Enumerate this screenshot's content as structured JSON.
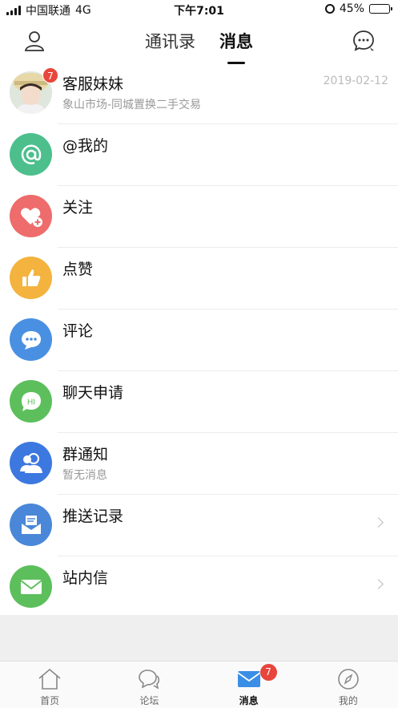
{
  "status_bar": {
    "carrier": "中国联通",
    "network": "4G",
    "time": "下午7:01",
    "battery": "45%",
    "battery_level": 0.45
  },
  "header": {
    "tabs": [
      {
        "label": "通讯录",
        "active": false
      },
      {
        "label": "消息",
        "active": true
      }
    ],
    "profile_icon": "person-icon",
    "chat_icon": "chat-bubble-icon"
  },
  "messages": [
    {
      "title": "客服妹妹",
      "subtitle": "象山市场-同城置换二手交易",
      "date": "2019-02-12",
      "badge": "7",
      "icon": "customer-service-avatar"
    },
    {
      "title": "@我的",
      "subtitle": "",
      "icon": "at-icon",
      "color": "#4cbf8c"
    },
    {
      "title": "关注",
      "subtitle": "",
      "icon": "heart-plus-icon",
      "color": "#ee6c6c"
    },
    {
      "title": "点赞",
      "subtitle": "",
      "icon": "thumbs-up-icon",
      "color": "#f3b33e"
    },
    {
      "title": "评论",
      "subtitle": "",
      "icon": "comment-icon",
      "color": "#4a90e2"
    },
    {
      "title": "聊天申请",
      "subtitle": "",
      "icon": "hi-chat-icon",
      "color": "#5cbf5c"
    },
    {
      "title": "群通知",
      "subtitle": "暂无消息",
      "icon": "group-icon",
      "color": "#3d78e0"
    },
    {
      "title": "推送记录",
      "subtitle": "",
      "icon": "push-record-icon",
      "color": "#4a87d8",
      "chevron": true
    },
    {
      "title": "站内信",
      "subtitle": "",
      "icon": "mail-icon",
      "color": "#5cbf5c",
      "chevron": true
    }
  ],
  "tabbar": [
    {
      "label": "首页",
      "icon": "home-icon",
      "active": false
    },
    {
      "label": "论坛",
      "icon": "forum-icon",
      "active": false
    },
    {
      "label": "消息",
      "icon": "message-icon",
      "active": true,
      "badge": "7"
    },
    {
      "label": "我的",
      "icon": "compass-icon",
      "active": false
    }
  ],
  "colors": {
    "badge": "#e8453c",
    "separator": "#ececec",
    "date_text": "#bbbbbb"
  }
}
